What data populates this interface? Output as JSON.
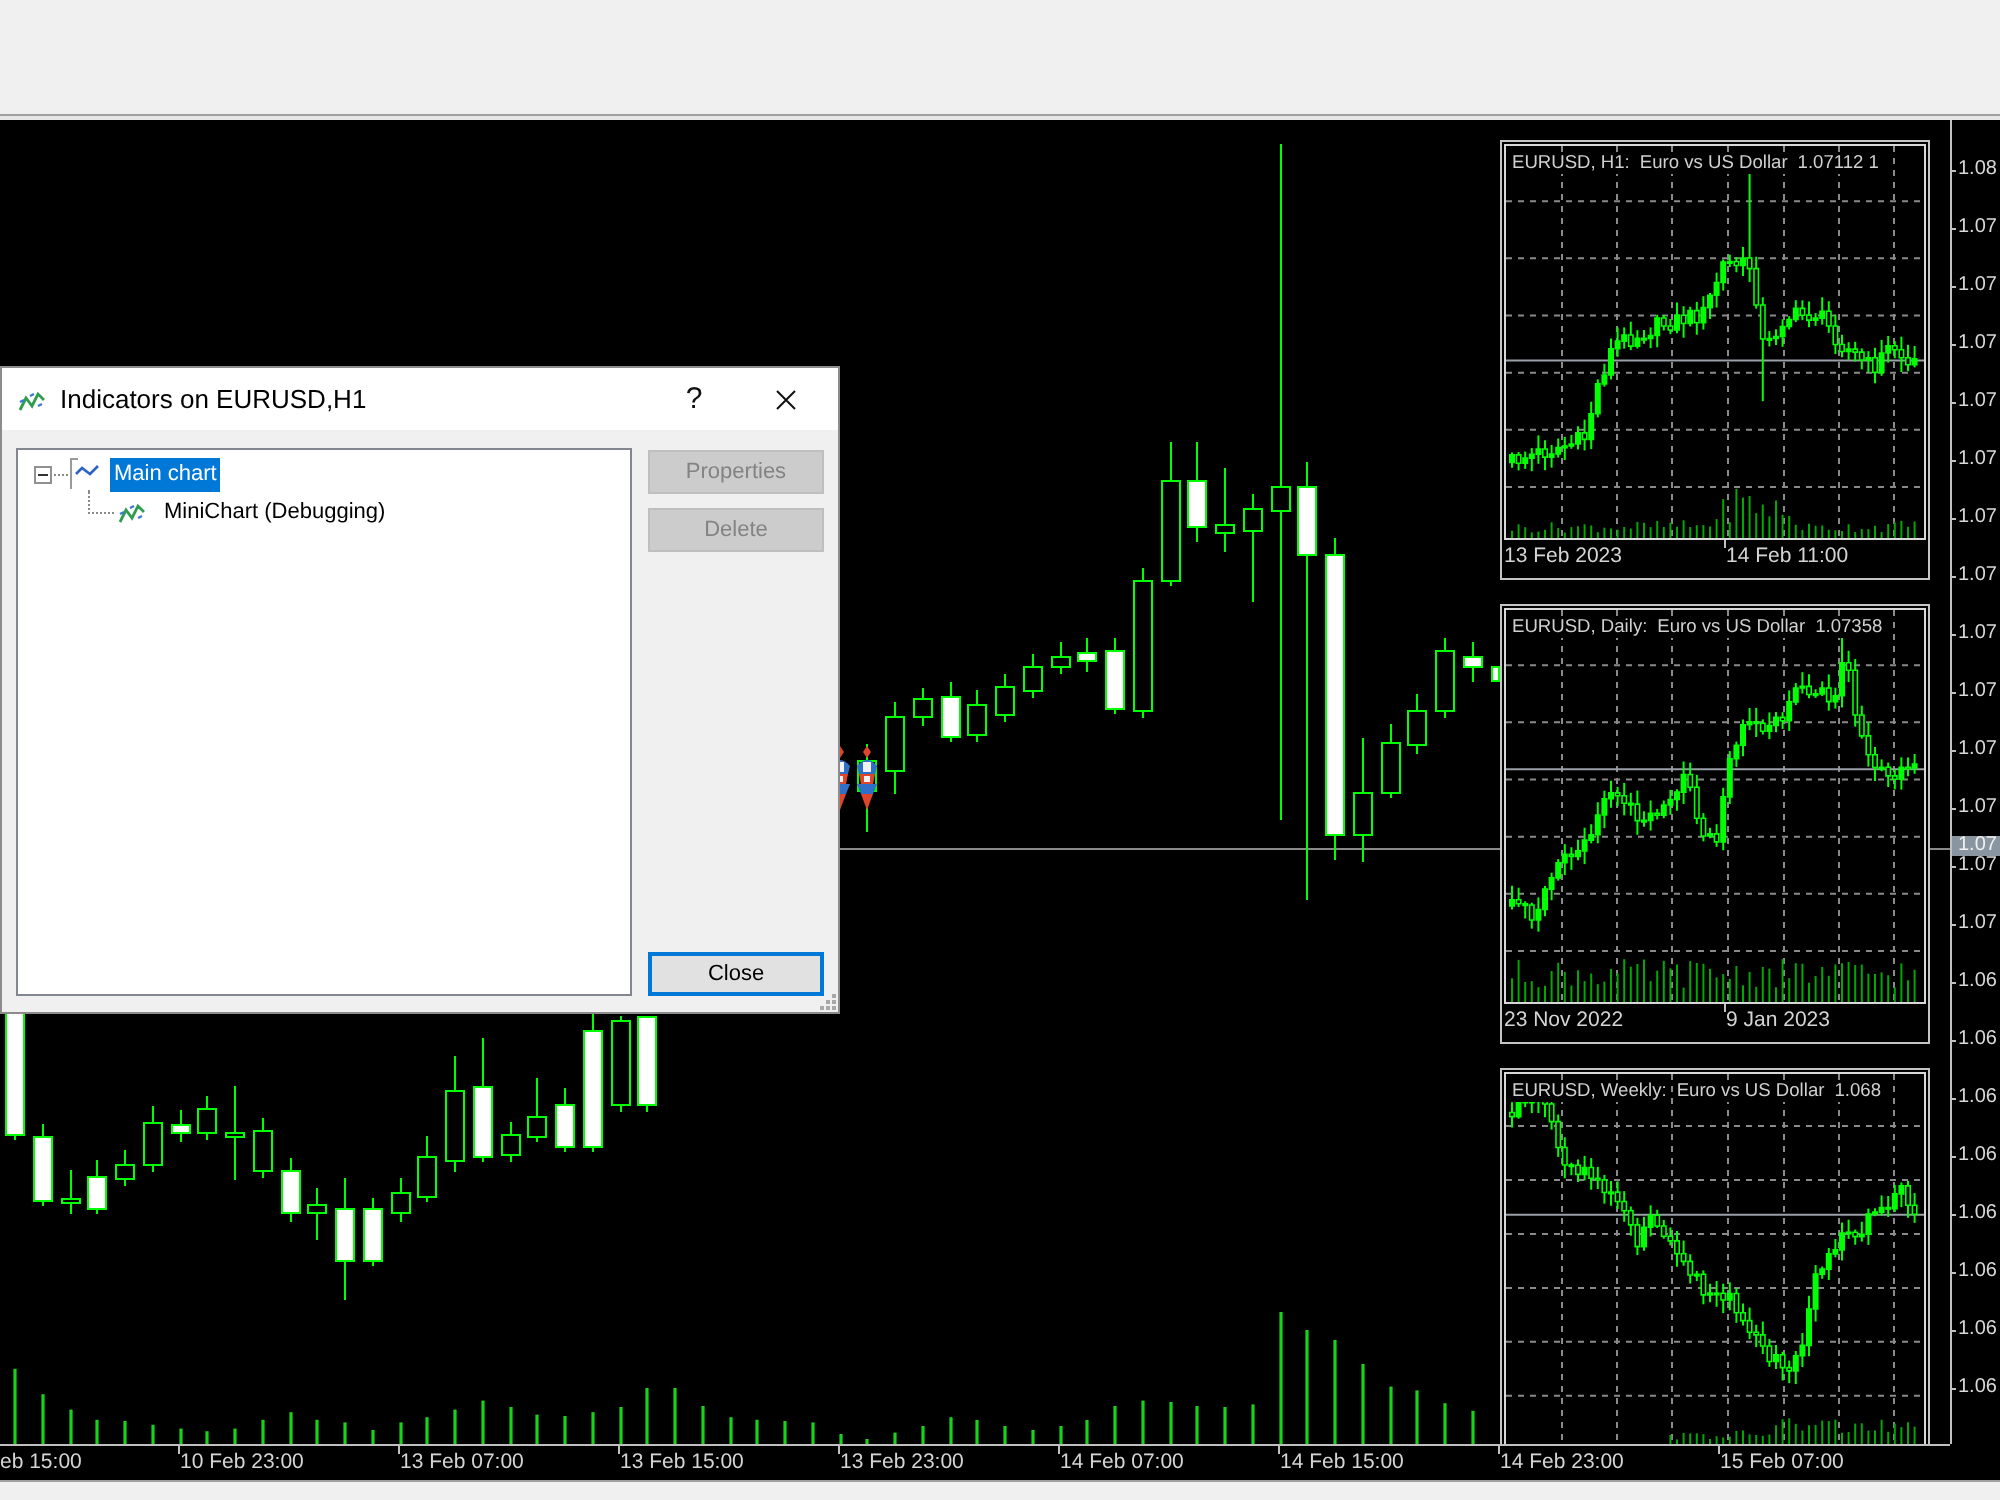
{
  "chart": {
    "price_axis": {
      "labels": [
        "1.08",
        "1.07",
        "1.07",
        "1.07",
        "1.07",
        "1.07",
        "1.07",
        "1.07",
        "1.07",
        "1.07",
        "1.07",
        "1.07",
        "1.07",
        "1.07",
        "1.06",
        "1.06",
        "1.06",
        "1.06",
        "1.06",
        "1.06",
        "1.06",
        "1.06"
      ],
      "current_price": "1.07"
    },
    "time_axis": {
      "labels": [
        "eb 15:00",
        "10 Feb 23:00",
        "13 Feb 07:00",
        "13 Feb 15:00",
        "13 Feb 23:00",
        "14 Feb 07:00",
        "14 Feb 15:00",
        "14 Feb 23:00",
        "15 Feb 07:00"
      ]
    },
    "mini_charts": [
      {
        "symbol": "EURUSD, H1:",
        "description": "Euro vs US Dollar",
        "price": "1.07112 1",
        "time_labels": [
          "13 Feb 2023",
          "14 Feb 11:00"
        ]
      },
      {
        "symbol": "EURUSD, Daily:",
        "description": "Euro vs US Dollar",
        "price": "1.07358",
        "time_labels": [
          "23 Nov 2022",
          "9 Jan 2023"
        ]
      },
      {
        "symbol": "EURUSD, Weekly:",
        "description": "Euro vs US Dollar",
        "price": "1.068"
      }
    ]
  },
  "dialog": {
    "title": "Indicators on EURUSD,H1",
    "help": "?",
    "tree": [
      {
        "label": "Main chart",
        "kind": "chart",
        "selected": true,
        "expanded": true,
        "children": [
          {
            "label": "MiniChart (Debugging)",
            "kind": "indicator",
            "selected": false
          }
        ]
      }
    ],
    "buttons": [
      {
        "label": "Properties",
        "disabled": true,
        "default": false
      },
      {
        "label": "Delete",
        "disabled": true,
        "default": false
      },
      {
        "label": "Close",
        "disabled": false,
        "default": true
      }
    ]
  }
}
